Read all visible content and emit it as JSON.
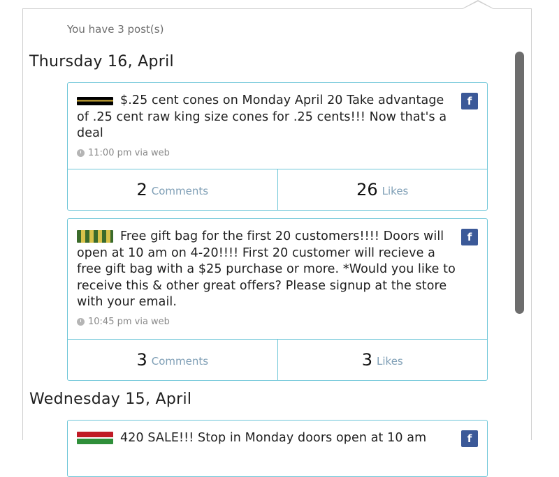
{
  "header": {
    "post_count": "You have 3 post(s)"
  },
  "days": [
    {
      "label": "Thursday 16, April",
      "posts": [
        {
          "text": "$.25 cent cones on Monday April 20 Take advantage of .25 cent raw king size cones for .25 cents!!! Now that's a deal",
          "time": "11:00 pm via web",
          "comments_count": "2",
          "comments_label": "Comments",
          "likes_count": "26",
          "likes_label": "Likes",
          "network": "f"
        },
        {
          "text": "Free gift bag for the first 20 customers!!!! Doors will open at 10 am on 4-20!!!! First 20 customer will recieve a free gift bag with a $25 purchase or more. *Would you like to receive this & other great offers? Please signup at the store with your email.",
          "time": "10:45 pm via web",
          "comments_count": "3",
          "comments_label": "Comments",
          "likes_count": "3",
          "likes_label": "Likes",
          "network": "f"
        }
      ]
    },
    {
      "label": "Wednesday 15, April",
      "posts": [
        {
          "text": "420 SALE!!! Stop in Monday doors open at 10 am",
          "network": "f"
        }
      ]
    }
  ],
  "colors": {
    "card_border": "#6ec6d8",
    "facebook": "#3b5998",
    "label_link": "#7f9fb6"
  }
}
